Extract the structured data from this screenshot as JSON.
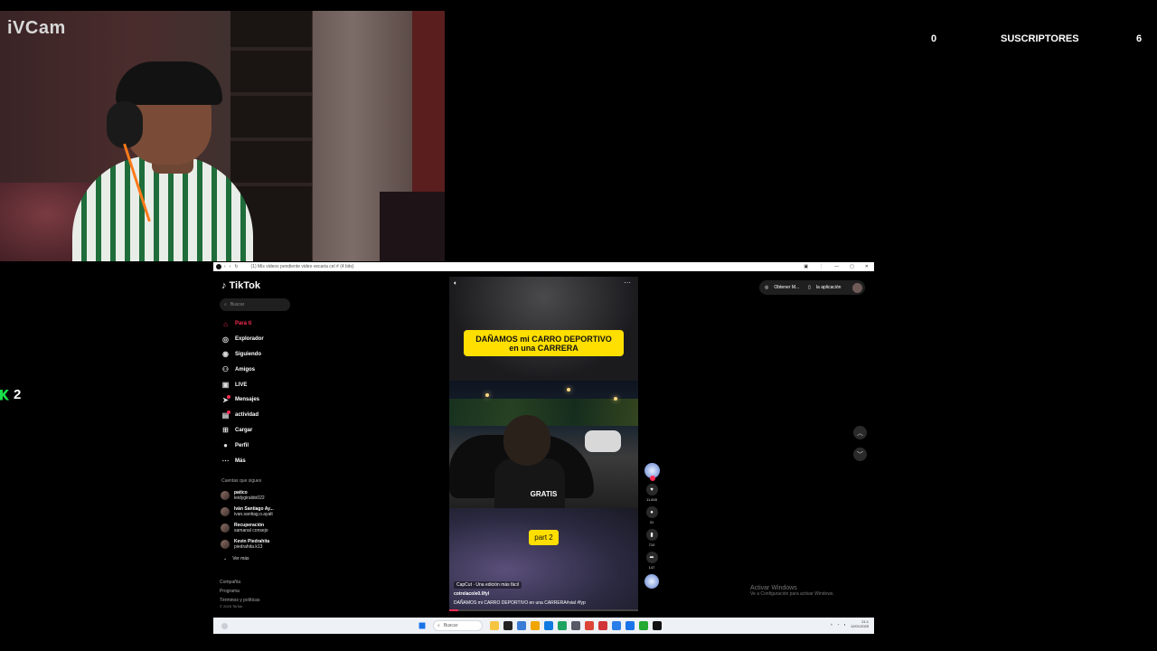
{
  "webcam": {
    "logo": "iVCam"
  },
  "stats": {
    "left_count": "0",
    "subscribers_label": "SUSCRIPTORES",
    "right_count": "6"
  },
  "side_counter": {
    "value": "2"
  },
  "browser": {
    "title_text": "(1) Mis videos pendiente video vecaria cel # (4 bits)"
  },
  "tiktok": {
    "logo": "TikTok",
    "search_placeholder": "Buscar",
    "nav": [
      {
        "label": "Para ti",
        "icon": "home-icon",
        "active": true
      },
      {
        "label": "Explorador",
        "icon": "compass-icon"
      },
      {
        "label": "Siguiendo",
        "icon": "following-icon"
      },
      {
        "label": "Amigos",
        "icon": "friends-icon"
      },
      {
        "label": "LIVE",
        "icon": "live-icon"
      },
      {
        "label": "Mensajes",
        "icon": "messages-icon"
      },
      {
        "label": "actividad",
        "icon": "activity-icon"
      },
      {
        "label": "Cargar",
        "icon": "upload-icon"
      },
      {
        "label": "Perfil",
        "icon": "profile-icon"
      },
      {
        "label": "Más",
        "icon": "more-icon"
      }
    ],
    "following_heading": "Cuentas que sigues",
    "following": [
      {
        "name": "patico",
        "handle": "leidygiraldo022"
      },
      {
        "name": "Iván Santiago Ay...",
        "handle": "ivan.santiag.o.ayalt"
      },
      {
        "name": "Recuperación",
        "handle": "samanal consejo"
      },
      {
        "name": "Kevin Piedrahita",
        "handle": "piedrahita.k13"
      }
    ],
    "see_more": "Ver más",
    "footer_links": [
      "Compañía",
      "Programa",
      "Términos y políticas"
    ],
    "copyright": "© 2025 TikTok",
    "top_actions": {
      "get_coins": "Obtener M...",
      "app": "la aplicación"
    },
    "video": {
      "headline_line1": "DAÑAMOS mi CARRO DEPORTIVO",
      "headline_line2": "en una CARRERA",
      "gratis_text": "GRATIS",
      "part_label": "part 2",
      "capcut_tag": "CapCut · Una edición más fácil",
      "author": "cotrelacole0.0fyl",
      "caption": "DAÑAMOS mi CARRO DEPORTIVO en una CARRERA#vial #fyp",
      "progress": 0.05
    },
    "rail": [
      {
        "icon": "heart-icon",
        "count": "11.600"
      },
      {
        "icon": "comment-icon",
        "count": "31"
      },
      {
        "icon": "bookmark-icon",
        "count": "710"
      },
      {
        "icon": "share-icon",
        "count": "147"
      }
    ]
  },
  "watermark": {
    "line1": "Activar Windows",
    "line2": "Ve a Configuración para activar Windows."
  },
  "taskbar": {
    "search_placeholder": "Buscar",
    "time": "21:1",
    "date": "12/01/2025",
    "app_colors": [
      "#f5c542",
      "#222222",
      "#3a7bd5",
      "#f0a500",
      "#0f7be0",
      "#1ea362",
      "#555a66",
      "#db4437",
      "#d13438",
      "#2b7de9",
      "#1a73e8",
      "#22aa33",
      "#111111"
    ]
  }
}
